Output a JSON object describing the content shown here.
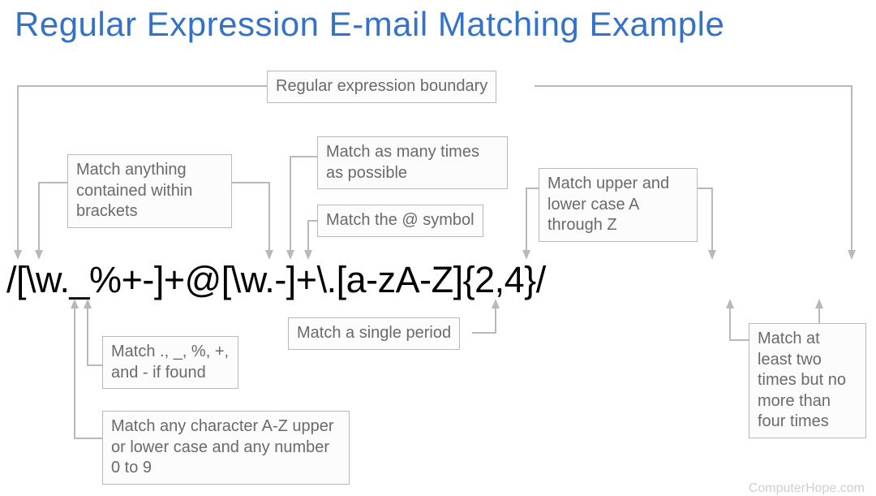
{
  "title": "Regular Expression E-mail Matching Example",
  "regex": "/[\\w._%+-]+@[\\w.-]+\\.[a-zA-Z]{2,4}/",
  "callouts": {
    "boundary": "Regular expression boundary",
    "brackets": "Match anything contained within brackets",
    "plus": "Match as many times as possible",
    "at": "Match the @ symbol",
    "azAZ": "Match upper and lower case A through Z",
    "specials": "Match ., _, %, +, and - if found",
    "period": "Match a single period",
    "wordchar": "Match any character A-Z upper or lower case and any number 0 to 9",
    "quant": "Match at least two times but no more than four times"
  },
  "attribution": "ComputerHope.com"
}
